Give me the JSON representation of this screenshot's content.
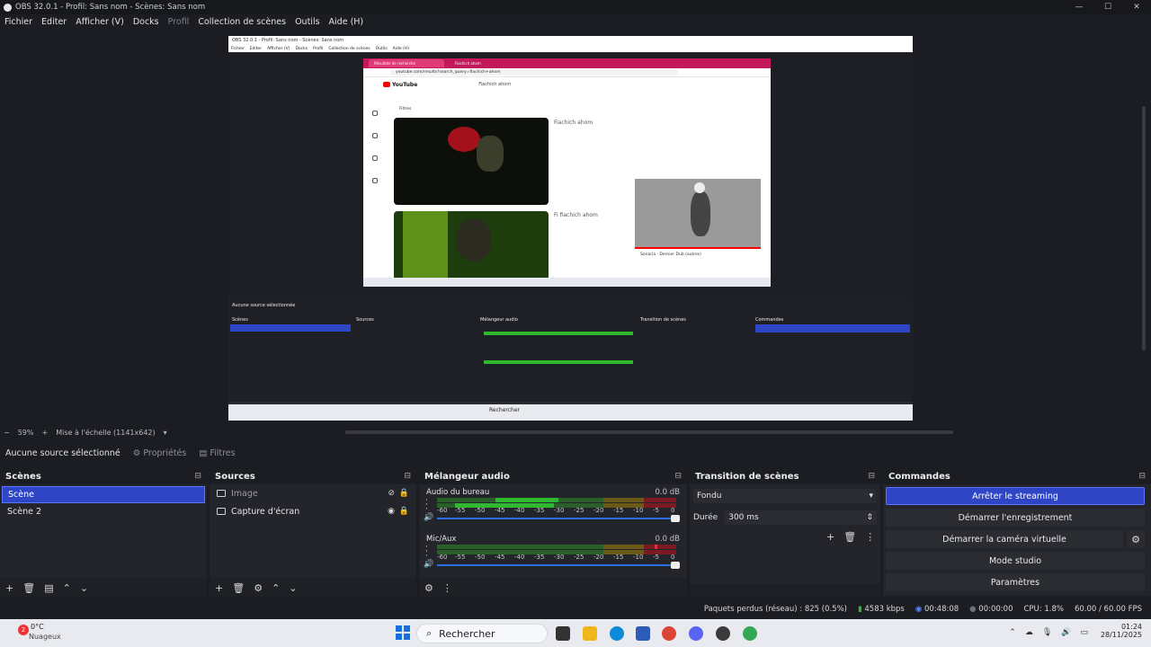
{
  "window": {
    "title": "OBS 32.0.1 - Profil: Sans nom - Scènes: Sans nom",
    "min": "—",
    "max": "☐",
    "close": "✕"
  },
  "menu": [
    "Fichier",
    "Editer",
    "Afficher (V)",
    "Docks",
    "Profil",
    "Collection de scènes",
    "Outils",
    "Aide (H)"
  ],
  "preview": {
    "inner_title": "OBS 32.0.1 - Profil: Sans nom - Scènes: Sans nom",
    "inner_menu": [
      "Fichier",
      "Editer",
      "Afficher (V)",
      "Docks",
      "Profil",
      "Collection de scènes",
      "Outils",
      "Aide (H)"
    ],
    "browser_tab1": "Résultats de recherche",
    "browser_tab2": "Fiachich ahom",
    "browser_url": "youtube.com/results?search_query=fiachich+ahom",
    "yt_brand": "YouTube",
    "yt_search": "Fiachich ahom",
    "yt_filter": "Filtres",
    "video1_title": "Fiachich ahom",
    "video2_title": "Fi fiachich ahom",
    "mini_caption": "Sonaria · Dernier Dub (autres)",
    "inner_scenes": "Scènes",
    "inner_sources": "Sources",
    "inner_mixer": "Mélangeur audio",
    "inner_transition": "Transition de scènes",
    "inner_commands": "Commandes",
    "inner_search": "Rechercher",
    "inner_nosel": "Aucune source sélectionnée"
  },
  "zoom": {
    "value": "59%",
    "scale": "Mise à l'échelle (1141x642)"
  },
  "context_bar": {
    "no_source": "Aucune source sélectionné",
    "properties": "Propriétés",
    "filters": "Filtres"
  },
  "scenes": {
    "title": "Scènes",
    "items": [
      "Scène",
      "Scène 2"
    ]
  },
  "sources": {
    "title": "Sources",
    "items": [
      "Image",
      "Capture d'écran"
    ]
  },
  "mixer": {
    "title": "Mélangeur audio",
    "channels": [
      {
        "name": "Audio du bureau",
        "db": "0.0 dB"
      },
      {
        "name": "Mic/Aux",
        "db": "0.0 dB"
      }
    ],
    "ticks": [
      "-60",
      "-55",
      "-50",
      "-45",
      "-40",
      "-35",
      "-30",
      "-25",
      "-20",
      "-15",
      "-10",
      "-5",
      "0"
    ]
  },
  "transitions": {
    "title": "Transition de scènes",
    "selected": "Fondu",
    "duration_label": "Durée",
    "duration_value": "300 ms"
  },
  "commands": {
    "title": "Commandes",
    "stop_stream": "Arrêter le streaming",
    "start_record": "Démarrer l'enregistrement",
    "start_vcam": "Démarrer la caméra virtuelle",
    "studio": "Mode studio",
    "settings": "Paramètres"
  },
  "status": {
    "dropped": "Paquets perdus (réseau) : 825 (0.5%)",
    "bitrate": "4583 kbps",
    "stream_time": "00:48:08",
    "rec_time": "00:00:00",
    "cpu": "CPU: 1.8%",
    "fps": "60.00 / 60.00 FPS"
  },
  "taskbar": {
    "weather_temp": "0°C",
    "weather_desc": "Nuageux",
    "weather_badge": "2",
    "search": "Rechercher",
    "time": "01:24",
    "date": "28/11/2025"
  },
  "colors": {
    "accent": "#2e45c6",
    "meter_green": "#2fb830",
    "meter_yellow": "#b7a21c",
    "meter_red": "#c0202c"
  }
}
